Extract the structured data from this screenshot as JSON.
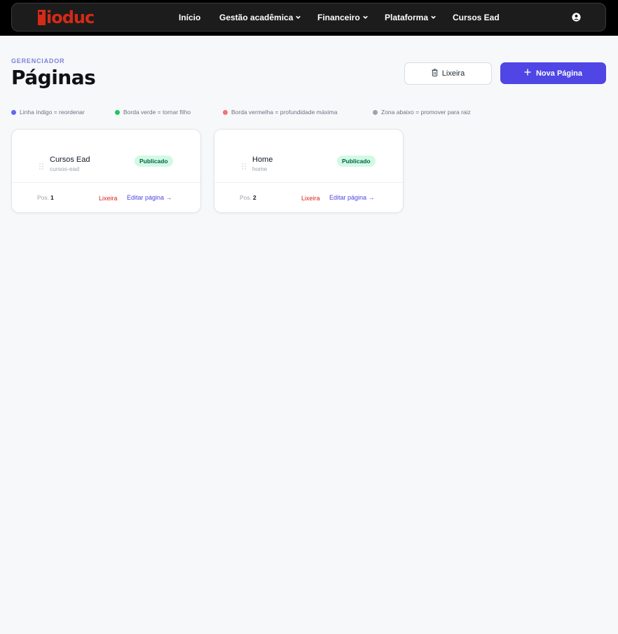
{
  "brand": {
    "logo_text": "ioduc",
    "accent": "#d42a16"
  },
  "nav": {
    "items": [
      {
        "label": "Início"
      },
      {
        "label": "Gestão acadêmica"
      },
      {
        "label": "Financeiro"
      },
      {
        "label": "Plataforma"
      },
      {
        "label": "Cursos Ead"
      }
    ]
  },
  "header": {
    "eyebrow": "GERENCIADOR",
    "title": "Páginas",
    "trash_button": "Lixeira",
    "new_button": "Nova Página"
  },
  "legend": [
    {
      "label": "Linha índigo = reordenar",
      "color": "#6366f1"
    },
    {
      "label": "Borda verde = tornar filho",
      "color": "#22c55e"
    },
    {
      "label": "Borda vermelha = profundidade máxima",
      "color": "#f87171"
    },
    {
      "label": "Zona abaixo = promover para raiz",
      "color": "#9ca3af"
    }
  ],
  "pages": [
    {
      "name": "Cursos Ead",
      "slug": "cursos-ead",
      "status": "Publicado",
      "pos_label": "Pos.",
      "pos": "1",
      "trash": "Lixeira",
      "edit": "Editar página →"
    },
    {
      "name": "Home",
      "slug": "home",
      "status": "Publicado",
      "pos_label": "Pos.",
      "pos": "2",
      "trash": "Lixeira",
      "edit": "Editar página →"
    }
  ],
  "colors": {
    "primary": "#4f46e5",
    "success_bg": "#d1fae5",
    "danger": "#dc2626"
  }
}
